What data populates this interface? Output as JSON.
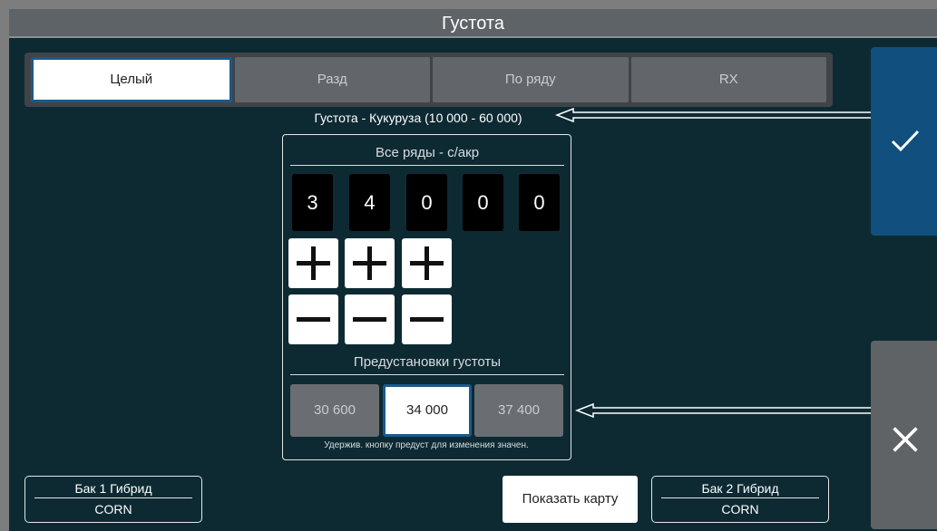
{
  "header": {
    "title": "Густота"
  },
  "tabs": [
    {
      "label": "Целый",
      "active": true
    },
    {
      "label": "Разд",
      "active": false
    },
    {
      "label": "По ряду",
      "active": false
    },
    {
      "label": "RX",
      "active": false
    }
  ],
  "range_label": "Густота - Кукуруза (10 000 - 60 000)",
  "panel": {
    "header": "Все ряды - с/акр",
    "digits": [
      "3",
      "4",
      "0",
      "0",
      "0"
    ],
    "presets_header": "Предустановки густоты",
    "presets": [
      {
        "label": "30 600",
        "active": false
      },
      {
        "label": "34 000",
        "active": true
      },
      {
        "label": "37 400",
        "active": false
      }
    ],
    "hint": "Удержив. кнопку предуст для изменения значен."
  },
  "tank1": {
    "title": "Бак 1 Гибрид",
    "value": "CORN"
  },
  "tank2": {
    "title": "Бак 2 Гибрид",
    "value": "CORN"
  },
  "map_button": "Показать карту",
  "icons": {
    "ok": "check-icon",
    "cancel": "close-icon",
    "plus": "plus-icon",
    "minus": "minus-icon"
  },
  "colors": {
    "background": "#0d2a33",
    "accent": "#114f7e",
    "tab_inactive": "#62666a"
  }
}
